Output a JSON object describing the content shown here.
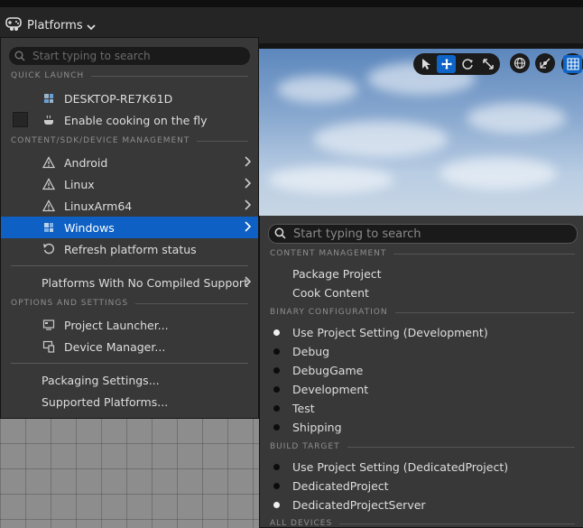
{
  "toolbar": {
    "platforms_label": "Platforms"
  },
  "platforms_menu": {
    "search_placeholder": "Start typing to search",
    "sections": {
      "quick_launch": "QUICK LAUNCH",
      "content_sdk": "CONTENT/SDK/DEVICE MANAGEMENT",
      "options": "OPTIONS AND SETTINGS"
    },
    "quick_launch": {
      "device": "DESKTOP-RE7K61D",
      "cook_on_fly": "Enable cooking on the fly"
    },
    "platforms": [
      {
        "label": "Android",
        "icon": "warning-icon"
      },
      {
        "label": "Linux",
        "icon": "warning-icon"
      },
      {
        "label": "LinuxArm64",
        "icon": "warning-icon"
      },
      {
        "label": "Windows",
        "icon": "windows-icon"
      }
    ],
    "refresh": "Refresh platform status",
    "no_compiled": "Platforms With No Compiled Support",
    "options": {
      "project_launcher": "Project Launcher...",
      "device_manager": "Device Manager..."
    },
    "packaging_settings": "Packaging Settings...",
    "supported_platforms": "Supported Platforms..."
  },
  "windows_submenu": {
    "search_placeholder": "Start typing to search",
    "sections": {
      "content_management": "CONTENT MANAGEMENT",
      "binary_configuration": "BINARY CONFIGURATION",
      "build_target": "BUILD TARGET",
      "all_devices": "ALL DEVICES"
    },
    "content": {
      "package_project": "Package Project",
      "cook_content": "Cook Content"
    },
    "binary_configs": [
      {
        "label": "Use Project Setting (Development)",
        "selected": true
      },
      {
        "label": "Debug",
        "selected": false
      },
      {
        "label": "DebugGame",
        "selected": false
      },
      {
        "label": "Development",
        "selected": false
      },
      {
        "label": "Test",
        "selected": false
      },
      {
        "label": "Shipping",
        "selected": false
      }
    ],
    "build_targets": [
      {
        "label": "Use Project Setting (DedicatedProject)",
        "selected": false
      },
      {
        "label": "DedicatedProject",
        "selected": false
      },
      {
        "label": "DedicatedProjectServer",
        "selected": true
      }
    ]
  },
  "colors": {
    "accent": "#0e60c4",
    "menu_bg": "#383838",
    "toolbar_bg": "#252525"
  }
}
